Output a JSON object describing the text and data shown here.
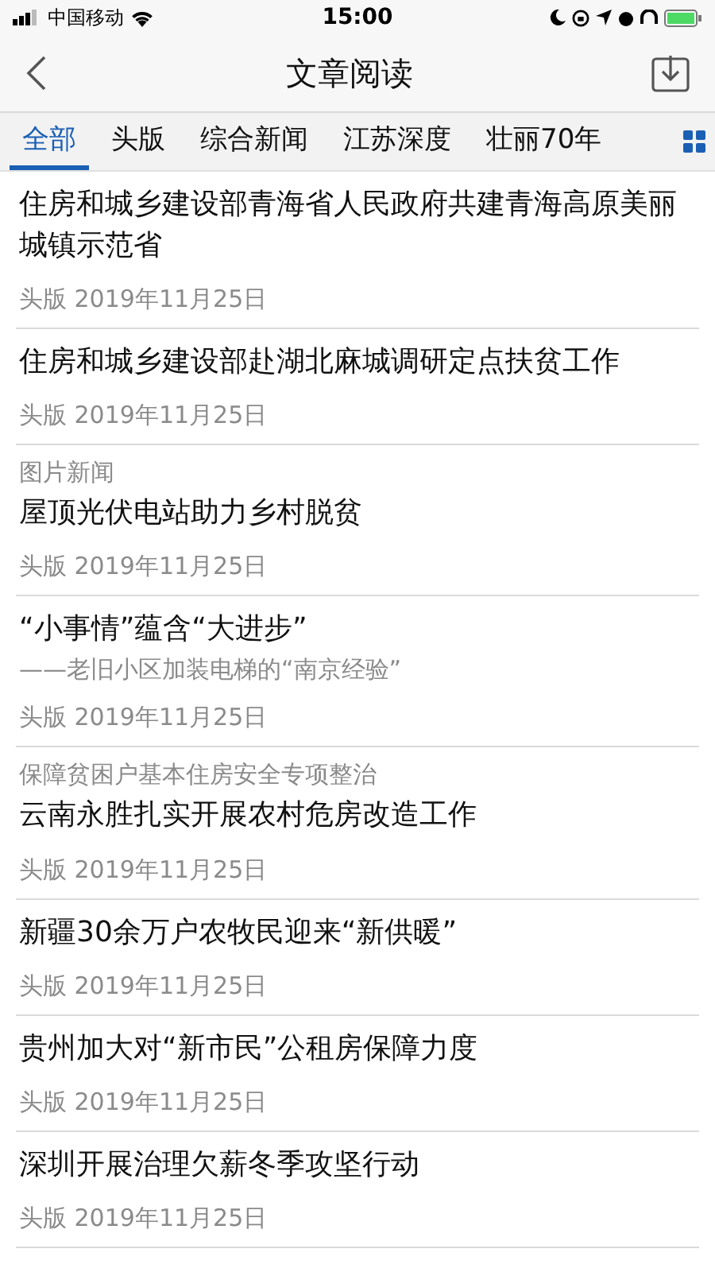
{
  "status_bar": {
    "carrier": "中国移动",
    "time": "15:00"
  },
  "nav": {
    "title": "文章阅读"
  },
  "tabs": [
    {
      "label": "全部",
      "selected": true
    },
    {
      "label": "头版",
      "selected": false
    },
    {
      "label": "综合新闻",
      "selected": false
    },
    {
      "label": "江苏深度",
      "selected": false
    },
    {
      "label": "壮丽70年",
      "selected": false
    }
  ],
  "articles": [
    {
      "title": "住房和城乡建设部青海省人民政府共建青海高原美丽城镇示范省",
      "meta": "头版 2019年11月25日"
    },
    {
      "title": "住房和城乡建设部赴湖北麻城调研定点扶贫工作",
      "meta": "头版 2019年11月25日"
    },
    {
      "kicker": "图片新闻",
      "title": "屋顶光伏电站助力乡村脱贫",
      "meta": "头版 2019年11月25日"
    },
    {
      "title": "“小事情”蕴含“大进步”",
      "subtitle": "——老旧小区加装电梯的“南京经验”",
      "meta": "头版 2019年11月25日"
    },
    {
      "kicker": "保障贫困户基本住房安全专项整治",
      "title": "云南永胜扎实开展农村危房改造工作",
      "meta": "头版 2019年11月25日"
    },
    {
      "title": "新疆30余万户农牧民迎来“新供暖”",
      "meta": "头版 2019年11月25日"
    },
    {
      "title": "贵州加大对“新市民”公租房保障力度",
      "meta": "头版 2019年11月25日"
    },
    {
      "title": "深圳开展治理欠薪冬季攻坚行动",
      "meta": "头版 2019年11月25日"
    }
  ]
}
